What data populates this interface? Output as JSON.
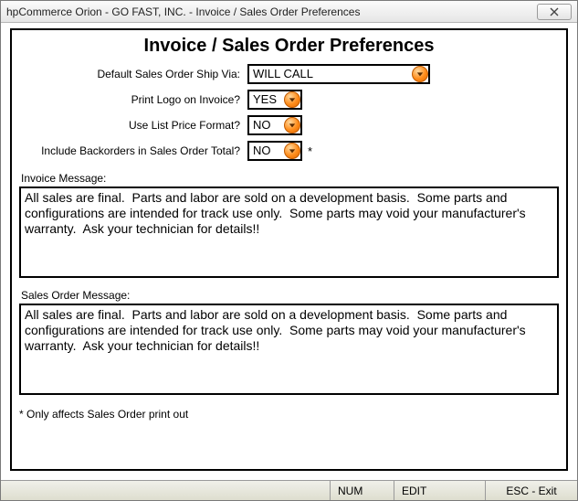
{
  "window": {
    "title": "hpCommerce Orion - GO FAST, INC. - Invoice / Sales Order Preferences"
  },
  "heading": "Invoice / Sales Order Preferences",
  "fields": {
    "ship_via": {
      "label": "Default Sales Order Ship Via:",
      "value": "WILL CALL"
    },
    "print_logo": {
      "label": "Print Logo on Invoice?",
      "value": "YES"
    },
    "list_price": {
      "label": "Use List Price Format?",
      "value": "NO"
    },
    "include_bo": {
      "label": "Include Backorders in Sales Order Total?",
      "value": "NO",
      "suffix": "*"
    }
  },
  "sections": {
    "invoice_msg_label": "Invoice Message:",
    "invoice_msg": "All sales are final.  Parts and labor are sold on a development basis.  Some parts and configurations are intended for track use only.  Some parts may void your manufacturer's warranty.  Ask your technician for details!!",
    "sales_msg_label": "Sales Order Message:",
    "sales_msg": "All sales are final.  Parts and labor are sold on a development basis.  Some parts and configurations are intended for track use only.  Some parts may void your manufacturer's warranty.  Ask your technician for details!!"
  },
  "footnote": "* Only affects Sales Order print out",
  "status": {
    "num": "NUM",
    "edit": "EDIT",
    "exit": "ESC - Exit"
  }
}
